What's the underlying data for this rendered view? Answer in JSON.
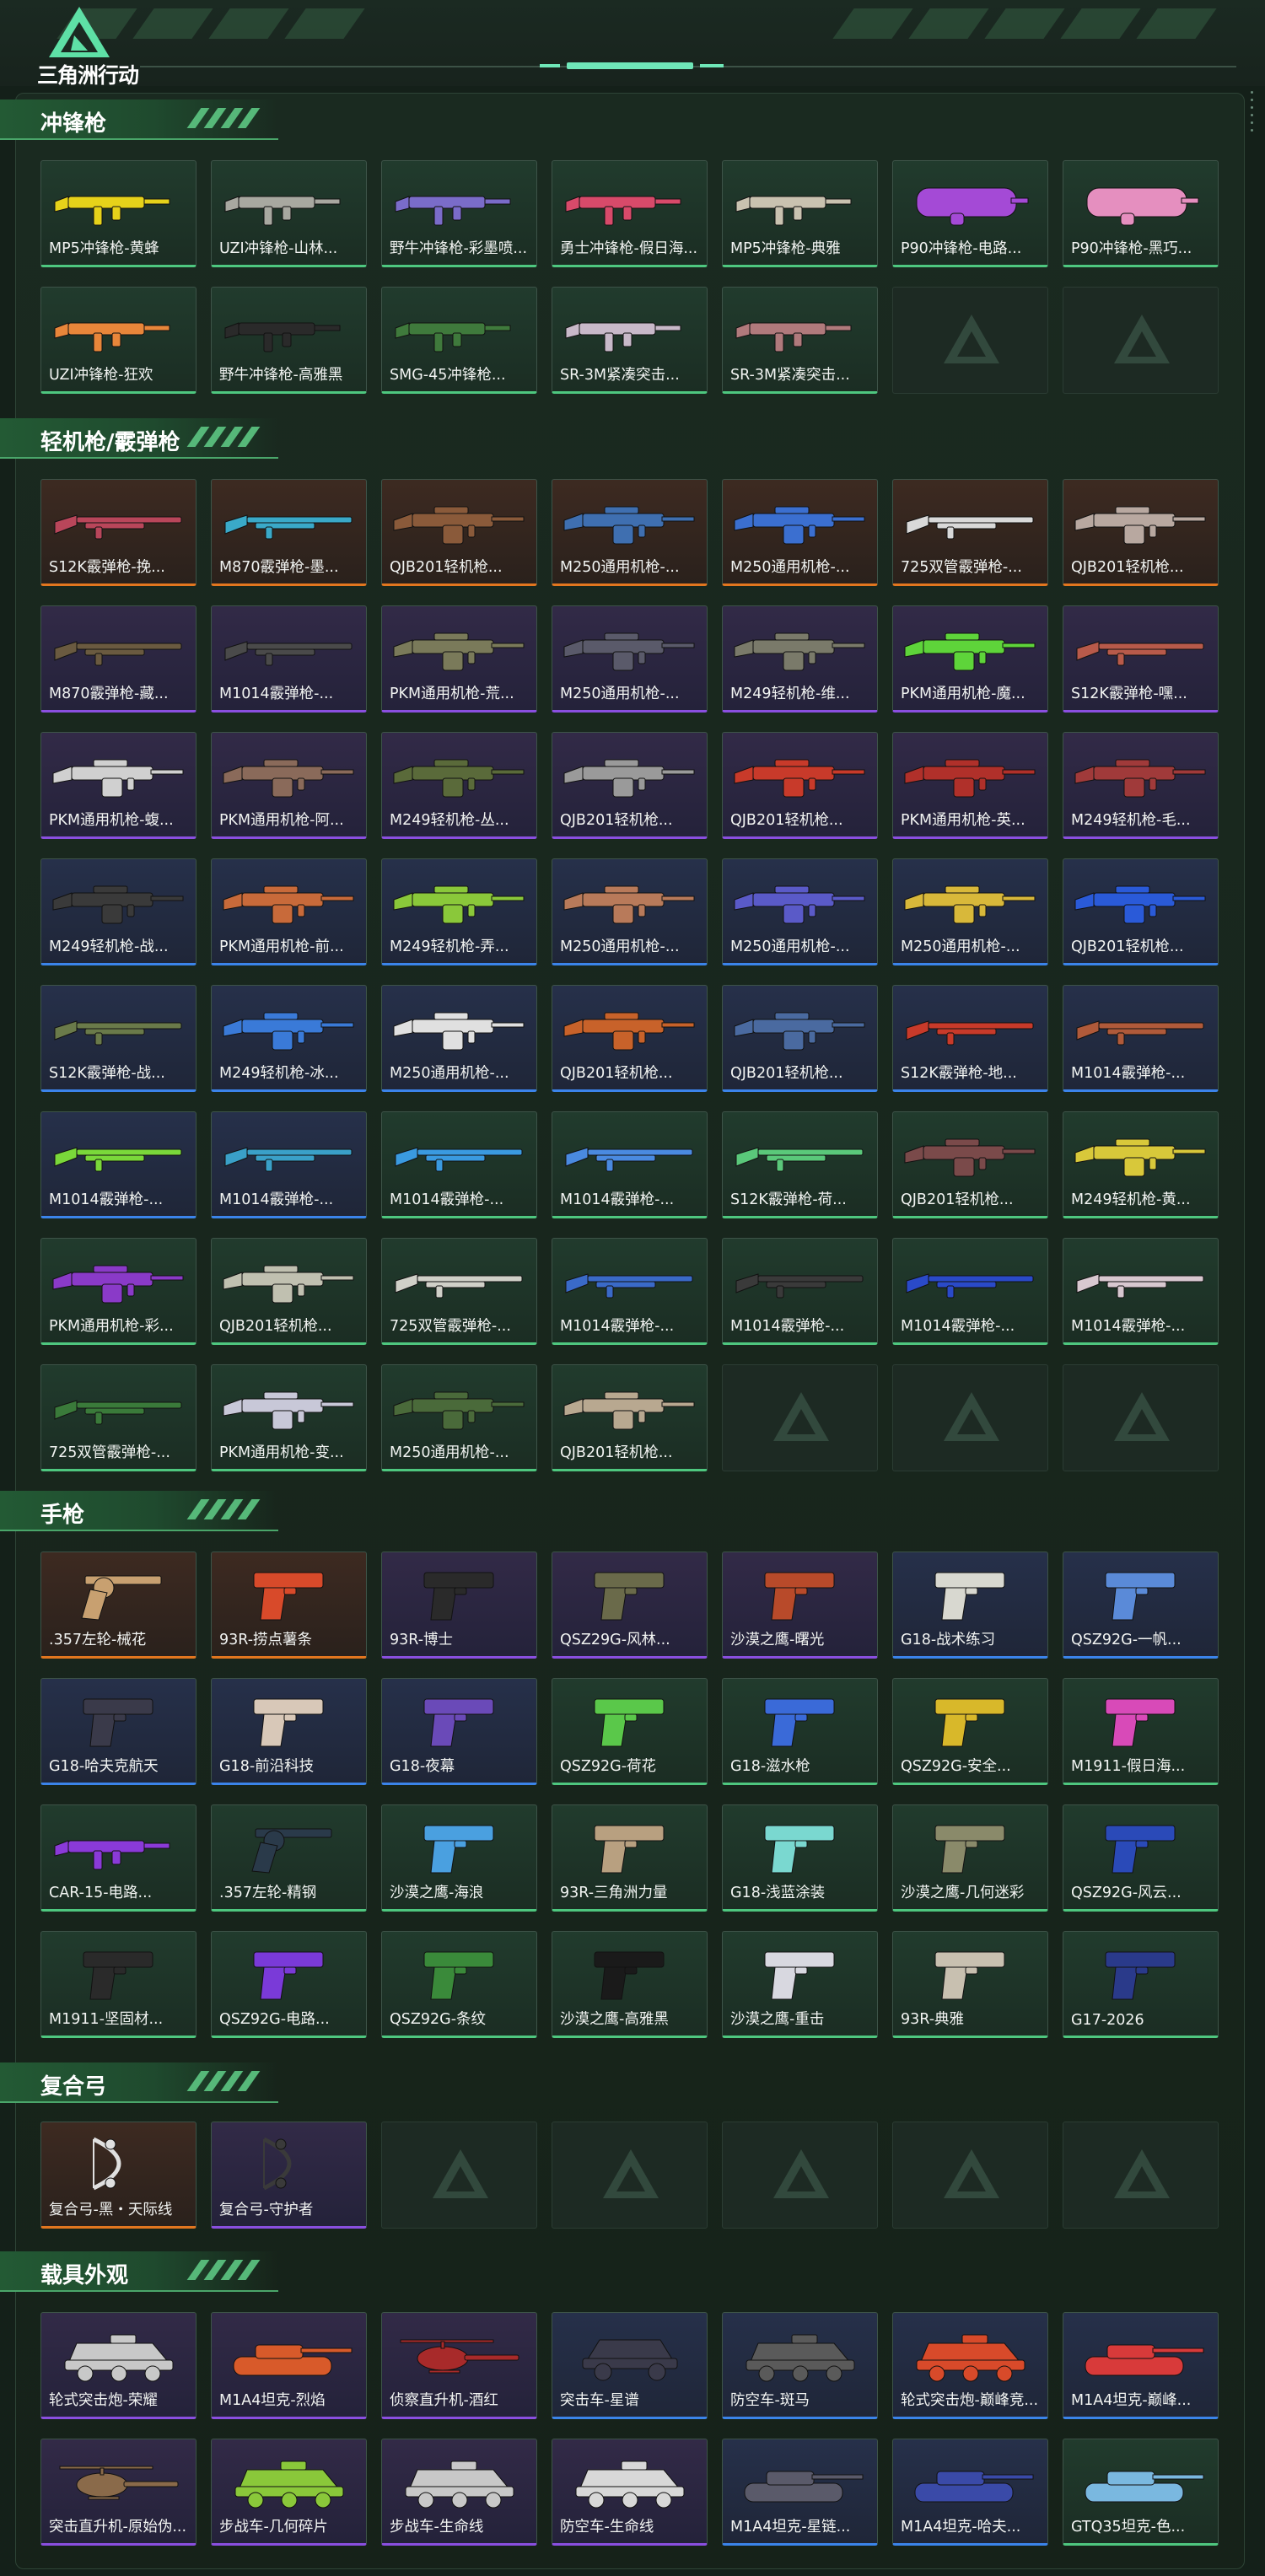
{
  "app": {
    "logo_text": "三角洲行动",
    "colors": {
      "background": "#142019",
      "accent": "#56b879",
      "rarity_orange": "#e2761f",
      "rarity_purple": "#8a4fe0",
      "rarity_blue": "#3b84ea",
      "rarity_green": "#4ec77f",
      "rarity_gray": "#8a9f94"
    }
  },
  "sections": [
    {
      "title": "冲锋枪",
      "items": [
        {
          "name": "MP5冲锋枪-黄蜂",
          "rarity": "green",
          "icon": "smg-icon",
          "tint": "#e6d21a"
        },
        {
          "name": "UZI冲锋枪-山林...",
          "rarity": "green",
          "icon": "smg-icon",
          "tint": "#a8a8a0"
        },
        {
          "name": "野牛冲锋枪-彩墨喷...",
          "rarity": "green",
          "icon": "smg-icon",
          "tint": "#7a6cc9"
        },
        {
          "name": "勇士冲锋枪-假日海...",
          "rarity": "green",
          "icon": "smg-icon",
          "tint": "#d84a6a"
        },
        {
          "name": "MP5冲锋枪-典雅",
          "rarity": "green",
          "icon": "smg-icon",
          "tint": "#c9c2b0"
        },
        {
          "name": "P90冲锋枪-电路...",
          "rarity": "green",
          "icon": "p90-icon",
          "tint": "#a44ad6"
        },
        {
          "name": "P90冲锋枪-黑巧...",
          "rarity": "green",
          "icon": "p90-icon",
          "tint": "#e58fbf"
        },
        {
          "name": "UZI冲锋枪-狂欢",
          "rarity": "green",
          "icon": "smg-icon",
          "tint": "#e8863a"
        },
        {
          "name": "野牛冲锋枪-高雅黑",
          "rarity": "green",
          "icon": "smg-icon",
          "tint": "#2a2a2a"
        },
        {
          "name": "SMG-45冲锋枪...",
          "rarity": "green",
          "icon": "smg-icon",
          "tint": "#3f7a3c"
        },
        {
          "name": "SR-3M紧凑突击...",
          "rarity": "green",
          "icon": "smg-icon",
          "tint": "#c8b9c9"
        },
        {
          "name": "SR-3M紧凑突击...",
          "rarity": "green",
          "icon": "smg-icon",
          "tint": "#b07a7c"
        },
        {
          "empty": true
        },
        {
          "empty": true
        }
      ]
    },
    {
      "title": "轻机枪/霰弹枪",
      "items": [
        {
          "name": "S12K霰弹枪-挽...",
          "rarity": "orange",
          "icon": "shotgun-icon",
          "tint": "#b9465a"
        },
        {
          "name": "M870霰弹枪-墨...",
          "rarity": "orange",
          "icon": "shotgun-icon",
          "tint": "#3aa9c8"
        },
        {
          "name": "QJB201轻机枪...",
          "rarity": "orange",
          "icon": "lmg-icon",
          "tint": "#8a5a3a"
        },
        {
          "name": "M250通用机枪-...",
          "rarity": "orange",
          "icon": "lmg-icon",
          "tint": "#3f6fb0"
        },
        {
          "name": "M250通用机枪-...",
          "rarity": "orange",
          "icon": "lmg-icon",
          "tint": "#3b6fd0"
        },
        {
          "name": "725双管霰弹枪-...",
          "rarity": "orange",
          "icon": "shotgun-icon",
          "tint": "#d9d9d9"
        },
        {
          "name": "QJB201轻机枪...",
          "rarity": "orange",
          "icon": "lmg-icon",
          "tint": "#b8a8a0"
        },
        {
          "name": "M870霰弹枪-藏...",
          "rarity": "purple",
          "icon": "shotgun-icon",
          "tint": "#6a5a40"
        },
        {
          "name": "M1014霰弹枪-...",
          "rarity": "purple",
          "icon": "shotgun-icon",
          "tint": "#4a4a4a"
        },
        {
          "name": "PKM通用机枪-荒...",
          "rarity": "purple",
          "icon": "lmg-icon",
          "tint": "#7a7a5a"
        },
        {
          "name": "M250通用机枪-...",
          "rarity": "purple",
          "icon": "lmg-icon",
          "tint": "#5a5a6a"
        },
        {
          "name": "M249轻机枪-维...",
          "rarity": "purple",
          "icon": "lmg-icon",
          "tint": "#7a7a6a"
        },
        {
          "name": "PKM通用机枪-魔...",
          "rarity": "purple",
          "icon": "lmg-icon",
          "tint": "#5ed43a"
        },
        {
          "name": "S12K霰弹枪-嘿...",
          "rarity": "purple",
          "icon": "shotgun-icon",
          "tint": "#b85a4a"
        },
        {
          "name": "PKM通用机枪-蝮...",
          "rarity": "purple",
          "icon": "lmg-icon",
          "tint": "#d0d0d0"
        },
        {
          "name": "PKM通用机枪-阿...",
          "rarity": "purple",
          "icon": "lmg-icon",
          "tint": "#8a6a5a"
        },
        {
          "name": "M249轻机枪-丛...",
          "rarity": "purple",
          "icon": "lmg-icon",
          "tint": "#5a6a3a"
        },
        {
          "name": "QJB201轻机枪...",
          "rarity": "purple",
          "icon": "lmg-icon",
          "tint": "#9a9a9a"
        },
        {
          "name": "QJB201轻机枪...",
          "rarity": "purple",
          "icon": "lmg-icon",
          "tint": "#c83a2a"
        },
        {
          "name": "PKM通用机枪-英...",
          "rarity": "purple",
          "icon": "lmg-icon",
          "tint": "#b0302a"
        },
        {
          "name": "M249轻机枪-毛...",
          "rarity": "purple",
          "icon": "lmg-icon",
          "tint": "#a03a3a"
        },
        {
          "name": "M249轻机枪-战...",
          "rarity": "blue",
          "icon": "lmg-icon",
          "tint": "#3a3a3a"
        },
        {
          "name": "PKM通用机枪-前...",
          "rarity": "blue",
          "icon": "lmg-icon",
          "tint": "#c86a3a"
        },
        {
          "name": "M249轻机枪-弄...",
          "rarity": "blue",
          "icon": "lmg-icon",
          "tint": "#8ac83a"
        },
        {
          "name": "M250通用机枪-...",
          "rarity": "blue",
          "icon": "lmg-icon",
          "tint": "#b87a5a"
        },
        {
          "name": "M250通用机枪-...",
          "rarity": "blue",
          "icon": "lmg-icon",
          "tint": "#5a5ac8"
        },
        {
          "name": "M250通用机枪-...",
          "rarity": "blue",
          "icon": "lmg-icon",
          "tint": "#d8b83a"
        },
        {
          "name": "QJB201轻机枪...",
          "rarity": "blue",
          "icon": "lmg-icon",
          "tint": "#2a5ad8"
        },
        {
          "name": "S12K霰弹枪-战...",
          "rarity": "blue",
          "icon": "shotgun-icon",
          "tint": "#6a7a4a"
        },
        {
          "name": "M249轻机枪-冰...",
          "rarity": "blue",
          "icon": "lmg-icon",
          "tint": "#3a7ad8"
        },
        {
          "name": "M250通用机枪-...",
          "rarity": "blue",
          "icon": "lmg-icon",
          "tint": "#e0e0e0"
        },
        {
          "name": "QJB201轻机枪...",
          "rarity": "blue",
          "icon": "lmg-icon",
          "tint": "#c8622a"
        },
        {
          "name": "QJB201轻机枪...",
          "rarity": "blue",
          "icon": "lmg-icon",
          "tint": "#4a6aa0"
        },
        {
          "name": "S12K霰弹枪-地...",
          "rarity": "blue",
          "icon": "shotgun-icon",
          "tint": "#c83a2a"
        },
        {
          "name": "M1014霰弹枪-...",
          "rarity": "blue",
          "icon": "shotgun-icon",
          "tint": "#b05a3a"
        },
        {
          "name": "M1014霰弹枪-...",
          "rarity": "blue",
          "icon": "shotgun-icon",
          "tint": "#7ad83a"
        },
        {
          "name": "M1014霰弹枪-...",
          "rarity": "blue",
          "icon": "shotgun-icon",
          "tint": "#3aa0c8"
        },
        {
          "name": "M1014霰弹枪-...",
          "rarity": "green",
          "icon": "shotgun-icon",
          "tint": "#3a9ae0"
        },
        {
          "name": "M1014霰弹枪-...",
          "rarity": "green",
          "icon": "shotgun-icon",
          "tint": "#4a8ae0"
        },
        {
          "name": "S12K霰弹枪-荷...",
          "rarity": "green",
          "icon": "shotgun-icon",
          "tint": "#5ac87a"
        },
        {
          "name": "QJB201轻机枪...",
          "rarity": "green",
          "icon": "lmg-icon",
          "tint": "#7a4a4a"
        },
        {
          "name": "M249轻机枪-黄...",
          "rarity": "green",
          "icon": "lmg-icon",
          "tint": "#d8c83a"
        },
        {
          "name": "PKM通用机枪-彩...",
          "rarity": "green",
          "icon": "lmg-icon",
          "tint": "#8a3ac8"
        },
        {
          "name": "QJB201轻机枪...",
          "rarity": "green",
          "icon": "lmg-icon",
          "tint": "#c0c0b0"
        },
        {
          "name": "725双管霰弹枪-...",
          "rarity": "green",
          "icon": "shotgun-icon",
          "tint": "#d0d0c8"
        },
        {
          "name": "M1014霰弹枪-...",
          "rarity": "green",
          "icon": "shotgun-icon",
          "tint": "#3a6ac8"
        },
        {
          "name": "M1014霰弹枪-...",
          "rarity": "green",
          "icon": "shotgun-icon",
          "tint": "#3a3a3a"
        },
        {
          "name": "M1014霰弹枪-...",
          "rarity": "green",
          "icon": "shotgun-icon",
          "tint": "#2a4ac8"
        },
        {
          "name": "M1014霰弹枪-...",
          "rarity": "green",
          "icon": "shotgun-icon",
          "tint": "#d8c8d0"
        },
        {
          "name": "725双管霰弹枪-...",
          "rarity": "green",
          "icon": "shotgun-icon",
          "tint": "#3a7a3a"
        },
        {
          "name": "PKM通用机枪-变...",
          "rarity": "green",
          "icon": "lmg-icon",
          "tint": "#c8c8d8"
        },
        {
          "name": "M250通用机枪-...",
          "rarity": "green",
          "icon": "lmg-icon",
          "tint": "#4a6a3a"
        },
        {
          "name": "QJB201轻机枪...",
          "rarity": "green",
          "icon": "lmg-icon",
          "tint": "#b8a890"
        },
        {
          "empty": true
        },
        {
          "empty": true
        },
        {
          "empty": true
        }
      ]
    },
    {
      "title": "手枪",
      "items": [
        {
          "name": ".357左轮-械花",
          "rarity": "orange",
          "icon": "revolver-icon",
          "tint": "#c8a070"
        },
        {
          "name": "93R-捞点薯条",
          "rarity": "orange",
          "icon": "pistol-icon",
          "tint": "#d84a2a"
        },
        {
          "name": "93R-博士",
          "rarity": "purple",
          "icon": "pistol-icon",
          "tint": "#2a2a2a"
        },
        {
          "name": "QSZ29G-风林...",
          "rarity": "purple",
          "icon": "pistol-icon",
          "tint": "#6a6a4a"
        },
        {
          "name": "沙漠之鹰-曙光",
          "rarity": "purple",
          "icon": "pistol-icon",
          "tint": "#b84a2a"
        },
        {
          "name": "G18-战术练习",
          "rarity": "blue",
          "icon": "pistol-icon",
          "tint": "#d8d8d0"
        },
        {
          "name": "QSZ92G-一帆...",
          "rarity": "blue",
          "icon": "pistol-icon",
          "tint": "#5a8ad8"
        },
        {
          "name": "G18-哈夫克航天",
          "rarity": "blue",
          "icon": "pistol-icon",
          "tint": "#3a3a4a"
        },
        {
          "name": "G18-前沿科技",
          "rarity": "blue",
          "icon": "pistol-icon",
          "tint": "#d8c8b8"
        },
        {
          "name": "G18-夜幕",
          "rarity": "blue",
          "icon": "pistol-icon",
          "tint": "#6a4ab8"
        },
        {
          "name": "QSZ92G-荷花",
          "rarity": "green",
          "icon": "pistol-icon",
          "tint": "#5ac84a"
        },
        {
          "name": "G18-滋水枪",
          "rarity": "green",
          "icon": "pistol-icon",
          "tint": "#3a6ad8"
        },
        {
          "name": "QSZ92G-安全...",
          "rarity": "green",
          "icon": "pistol-icon",
          "tint": "#d8b82a"
        },
        {
          "name": "M1911-假日海...",
          "rarity": "green",
          "icon": "pistol-icon",
          "tint": "#d84ab8"
        },
        {
          "name": "CAR-15-电路...",
          "rarity": "green",
          "icon": "smg-icon",
          "tint": "#8a3ad8"
        },
        {
          "name": ".357左轮-精钢",
          "rarity": "green",
          "icon": "revolver-icon",
          "tint": "#2a3a4a"
        },
        {
          "name": "沙漠之鹰-海浪",
          "rarity": "green",
          "icon": "pistol-icon",
          "tint": "#4aa0e0"
        },
        {
          "name": "93R-三角洲力量",
          "rarity": "green",
          "icon": "pistol-icon",
          "tint": "#b8a080"
        },
        {
          "name": "G18-浅蓝涂装",
          "rarity": "green",
          "icon": "pistol-icon",
          "tint": "#7ad8d0"
        },
        {
          "name": "沙漠之鹰-几何迷彩",
          "rarity": "green",
          "icon": "pistol-icon",
          "tint": "#8a8a6a"
        },
        {
          "name": "QSZ92G-风云...",
          "rarity": "green",
          "icon": "pistol-icon",
          "tint": "#2a4ab8"
        },
        {
          "name": "M1911-坚固材...",
          "rarity": "green",
          "icon": "pistol-icon",
          "tint": "#2a2a2a"
        },
        {
          "name": "QSZ92G-电路...",
          "rarity": "green",
          "icon": "pistol-icon",
          "tint": "#7a3ad8"
        },
        {
          "name": "QSZ92G-条纹",
          "rarity": "green",
          "icon": "pistol-icon",
          "tint": "#3a8a3a"
        },
        {
          "name": "沙漠之鹰-高雅黑",
          "rarity": "green",
          "icon": "pistol-icon",
          "tint": "#1a1a1a"
        },
        {
          "name": "沙漠之鹰-重击",
          "rarity": "green",
          "icon": "pistol-icon",
          "tint": "#d8d8e0"
        },
        {
          "name": "93R-典雅",
          "rarity": "green",
          "icon": "pistol-icon",
          "tint": "#c8c0b0"
        },
        {
          "name": "G17-2026",
          "rarity": "green",
          "icon": "pistol-icon",
          "tint": "#2a3a8a"
        }
      ]
    },
    {
      "title": "复合弓",
      "items": [
        {
          "name": "复合弓-黑・天际线",
          "rarity": "orange",
          "icon": "bow-icon",
          "tint": "#e0e0e0"
        },
        {
          "name": "复合弓-守护者",
          "rarity": "purple",
          "icon": "bow-icon",
          "tint": "#3a3a3a"
        },
        {
          "empty": true
        },
        {
          "empty": true
        },
        {
          "empty": true
        },
        {
          "empty": true
        },
        {
          "empty": true
        }
      ]
    },
    {
      "title": "载具外观",
      "items": [
        {
          "name": "轮式突击炮-荣耀",
          "rarity": "purple",
          "icon": "armored-car-icon",
          "tint": "#c8c8c8"
        },
        {
          "name": "M1A4坦克-烈焰",
          "rarity": "purple",
          "icon": "tank-icon",
          "tint": "#d85a2a"
        },
        {
          "name": "侦察直升机-酒红",
          "rarity": "purple",
          "icon": "helicopter-icon",
          "tint": "#a82a2a"
        },
        {
          "name": "突击车-星谱",
          "rarity": "blue",
          "icon": "buggy-icon",
          "tint": "#3a3a4a"
        },
        {
          "name": "防空车-斑马",
          "rarity": "blue",
          "icon": "armored-car-icon",
          "tint": "#5a5a5a"
        },
        {
          "name": "轮式突击炮-巅峰竞...",
          "rarity": "blue",
          "icon": "armored-car-icon",
          "tint": "#d84a2a"
        },
        {
          "name": "M1A4坦克-巅峰...",
          "rarity": "blue",
          "icon": "tank-icon",
          "tint": "#d83a3a"
        },
        {
          "name": "突击直升机-原始伪...",
          "rarity": "purple",
          "icon": "helicopter-icon",
          "tint": "#8a6a4a"
        },
        {
          "name": "步战车-几何碎片",
          "rarity": "purple",
          "icon": "armored-car-icon",
          "tint": "#8ac83a"
        },
        {
          "name": "步战车-生命线",
          "rarity": "purple",
          "icon": "armored-car-icon",
          "tint": "#c8c8c8"
        },
        {
          "name": "防空车-生命线",
          "rarity": "purple",
          "icon": "armored-car-icon",
          "tint": "#d8d8d8"
        },
        {
          "name": "M1A4坦克-星链...",
          "rarity": "blue",
          "icon": "tank-icon",
          "tint": "#5a5a6a"
        },
        {
          "name": "M1A4坦克-哈夫...",
          "rarity": "blue",
          "icon": "tank-icon",
          "tint": "#3a4aa8"
        },
        {
          "name": "GTQ35坦克-色...",
          "rarity": "green",
          "icon": "tank-icon",
          "tint": "#7ab8e0"
        }
      ]
    }
  ]
}
